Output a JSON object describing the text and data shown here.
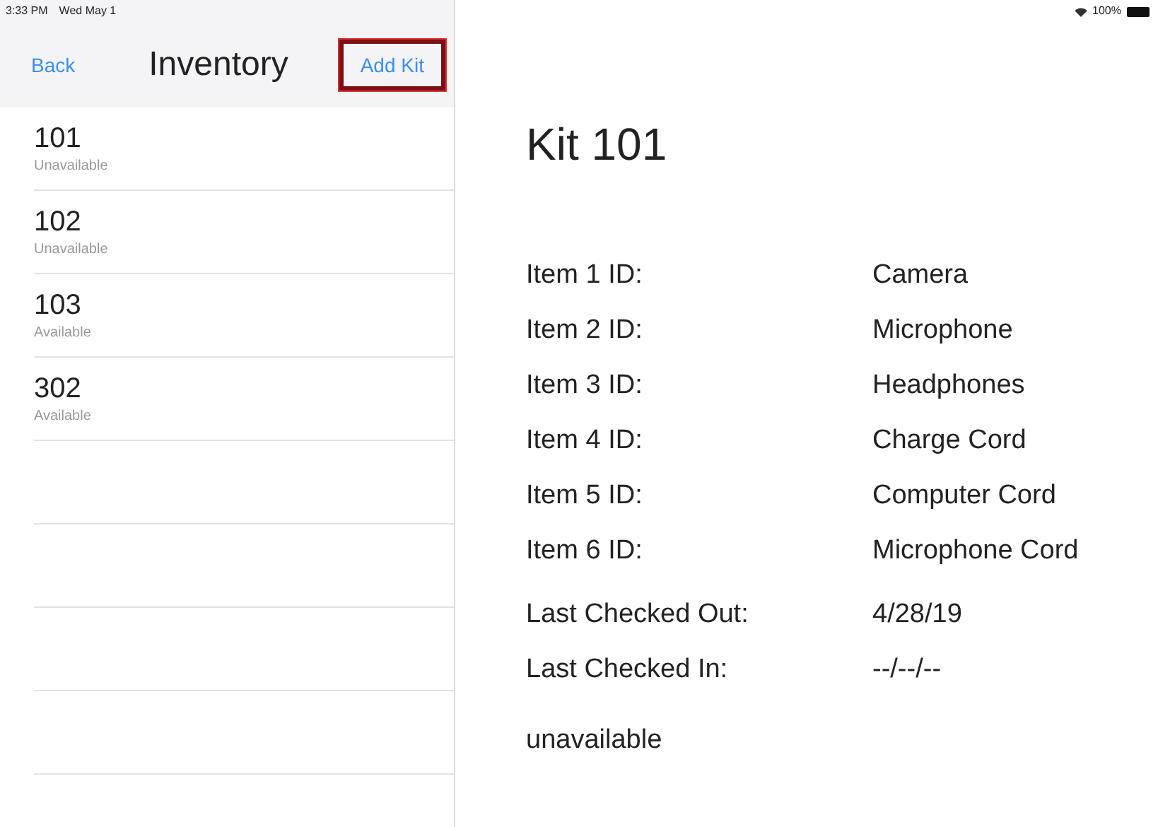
{
  "status_bar": {
    "time": "3:33 PM",
    "date": "Wed May 1",
    "battery": "100%"
  },
  "nav": {
    "back": "Back",
    "title": "Inventory",
    "action": {
      "label": "Add Kit",
      "highlighted": true
    }
  },
  "kits": [
    {
      "number": "101",
      "status": "Unavailable"
    },
    {
      "number": "102",
      "status": "Unavailable"
    },
    {
      "number": "103",
      "status": "Available"
    },
    {
      "number": "302",
      "status": "Available"
    }
  ],
  "detail": {
    "title": "Kit 101",
    "items": [
      {
        "label": "Item 1 ID:",
        "value": "Camera"
      },
      {
        "label": "Item 2 ID:",
        "value": "Microphone"
      },
      {
        "label": "Item 3 ID:",
        "value": "Headphones"
      },
      {
        "label": "Item 4 ID:",
        "value": "Charge Cord"
      },
      {
        "label": "Item 5 ID:",
        "value": "Computer Cord"
      },
      {
        "label": "Item 6 ID:",
        "value": "Microphone Cord"
      }
    ],
    "dates": [
      {
        "label": "Last Checked Out:",
        "value": "4/28/19"
      },
      {
        "label": "Last Checked In:",
        "value": "--/--/--"
      }
    ],
    "availability": "unavailable"
  }
}
